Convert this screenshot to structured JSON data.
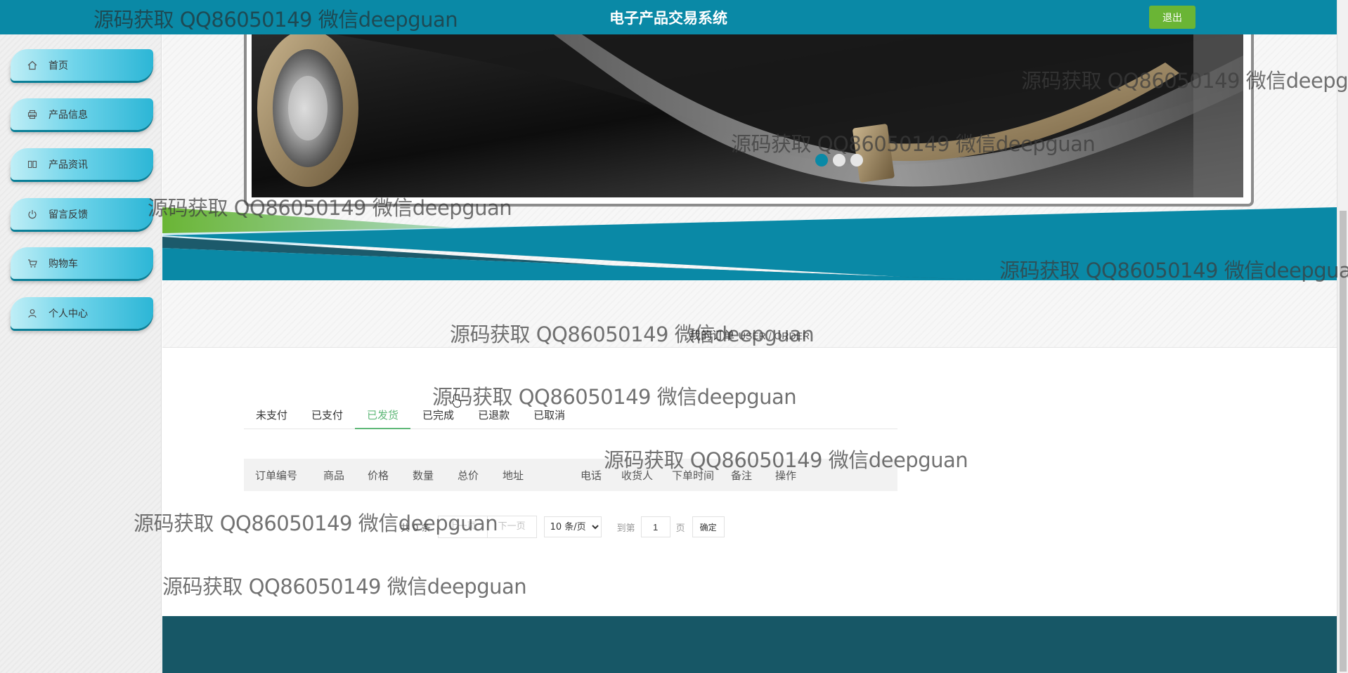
{
  "app": {
    "title": "电子产品交易系统",
    "logout_label": "退出"
  },
  "sidebar": {
    "items": [
      {
        "label": "首页",
        "icon": "home-icon"
      },
      {
        "label": "产品信息",
        "icon": "printer-icon"
      },
      {
        "label": "产品资讯",
        "icon": "book-icon"
      },
      {
        "label": "留言反馈",
        "icon": "power-icon"
      },
      {
        "label": "购物车",
        "icon": "cart-icon"
      },
      {
        "label": "个人中心",
        "icon": "user-icon"
      }
    ]
  },
  "carousel": {
    "slide_count": 3,
    "active_index": 0
  },
  "section": {
    "title_zh": "我的订单",
    "title_en": "USER / ORDER",
    "separator": "/"
  },
  "tabs": [
    {
      "label": "未支付",
      "active": false
    },
    {
      "label": "已支付",
      "active": false
    },
    {
      "label": "已发货",
      "active": true
    },
    {
      "label": "已完成",
      "active": false
    },
    {
      "label": "已退款",
      "active": false
    },
    {
      "label": "已取消",
      "active": false
    }
  ],
  "table": {
    "columns": [
      "订单编号",
      "商品",
      "价格",
      "数量",
      "总价",
      "地址",
      "电话",
      "收货人",
      "下单时间",
      "备注",
      "操作"
    ],
    "rows": []
  },
  "pagination": {
    "total_text": "共 0 条",
    "prev_label": "上一页",
    "next_label": "下一页",
    "page_size_option": "10 条/页",
    "goto_label": "到第",
    "page_value": "1",
    "page_word": "页",
    "confirm_label": "确定"
  },
  "watermark": {
    "text": "源码获取 QQ86050149 微信deepguan"
  },
  "colors": {
    "topbar": "#0a89a6",
    "logout_button": "#6ab535",
    "active_tab": "#5fb878",
    "footer": "#175766"
  }
}
